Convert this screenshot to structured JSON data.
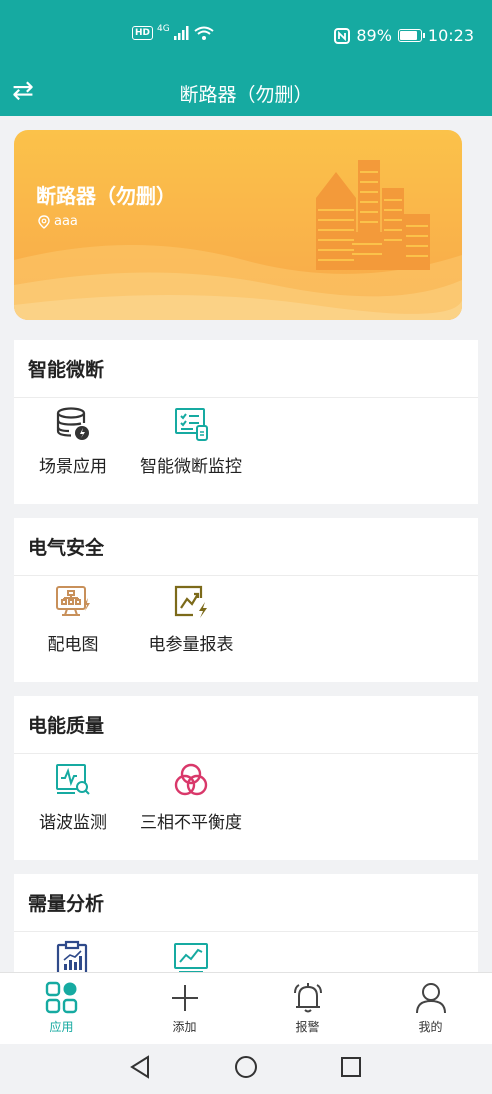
{
  "status": {
    "network": "4G",
    "battery": "89%",
    "time": "10:23",
    "battery_level": 0.89
  },
  "header": {
    "title": "断路器（勿删）"
  },
  "banner": {
    "title": "断路器（勿删）",
    "location": "aaa"
  },
  "sections": [
    {
      "title": "智能微断",
      "items": [
        {
          "label": "场景应用",
          "icon": "database-icon"
        },
        {
          "label": "智能微断监控",
          "icon": "monitor-list-icon"
        }
      ]
    },
    {
      "title": "电气安全",
      "items": [
        {
          "label": "配电图",
          "icon": "distribution-diagram-icon"
        },
        {
          "label": "电参量报表",
          "icon": "electric-report-icon"
        }
      ]
    },
    {
      "title": "电能质量",
      "items": [
        {
          "label": "谐波监测",
          "icon": "harmonic-monitor-icon"
        },
        {
          "label": "三相不平衡度",
          "icon": "three-phase-icon"
        }
      ]
    },
    {
      "title": "需量分析",
      "items": [
        {
          "label": "",
          "icon": "clipboard-chart-icon"
        },
        {
          "label": "",
          "icon": "trend-board-icon"
        }
      ]
    }
  ],
  "tabbar": [
    {
      "label": "应用",
      "icon": "apps-icon",
      "active": true
    },
    {
      "label": "添加",
      "icon": "plus-icon",
      "active": false
    },
    {
      "label": "报警",
      "icon": "bell-icon",
      "active": false
    },
    {
      "label": "我的",
      "icon": "user-icon",
      "active": false
    }
  ],
  "colors": {
    "primary": "#16aaa1",
    "banner": "#f8a84a",
    "report": "#2f4a8a",
    "diagram": "#c8905a",
    "phase": "#d9386a",
    "olive": "#7c6a1a"
  }
}
